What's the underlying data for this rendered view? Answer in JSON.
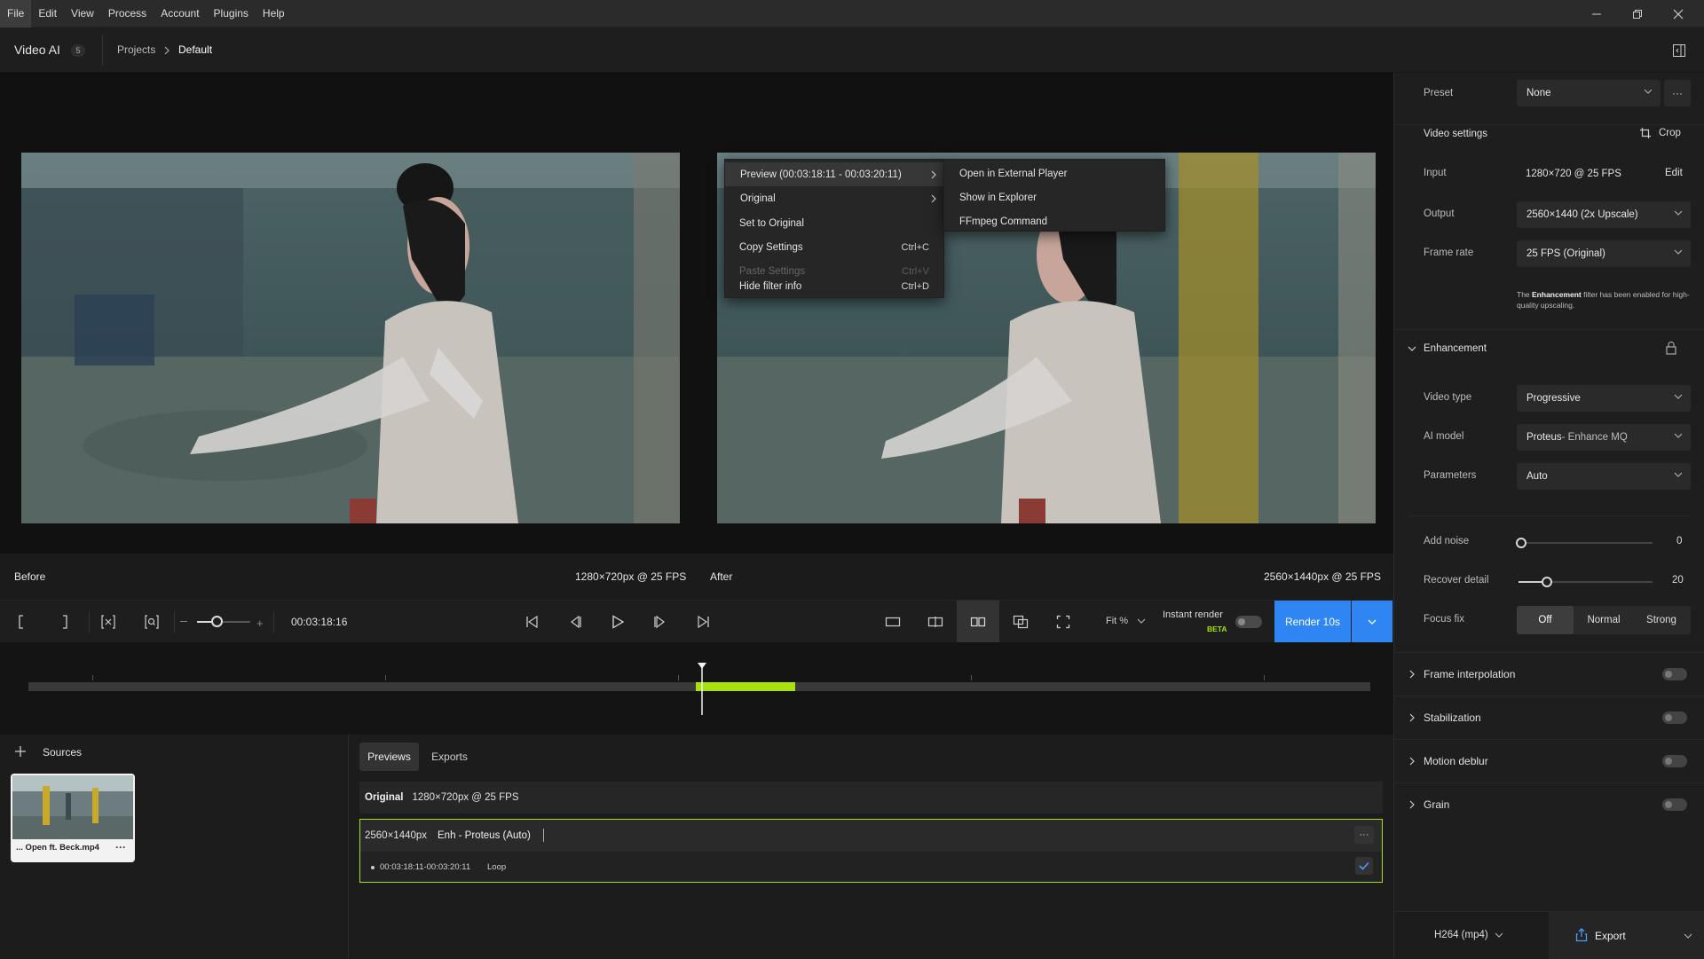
{
  "menubar": {
    "items": [
      "File",
      "Edit",
      "View",
      "Process",
      "Account",
      "Plugins",
      "Help"
    ]
  },
  "header": {
    "app_name": "Video AI",
    "app_badge": "5",
    "breadcrumb": [
      "Projects",
      "Default"
    ]
  },
  "viewer": {
    "before_label": "Before",
    "before_resolution": "1280×720px @ 25 FPS",
    "after_label": "After",
    "after_resolution": "2560×1440px @ 25 FPS"
  },
  "context_menu": {
    "items": [
      {
        "label": "Preview (00:03:18:11 - 00:03:20:11)",
        "shortcut": "",
        "submenu": true,
        "disabled": false
      },
      {
        "label": "Original",
        "shortcut": "",
        "submenu": true,
        "disabled": false
      },
      {
        "label": "Set to Original",
        "shortcut": "",
        "submenu": false,
        "disabled": false
      },
      {
        "label": "Copy Settings",
        "shortcut": "Ctrl+C",
        "submenu": false,
        "disabled": false
      },
      {
        "label": "Paste Settings",
        "shortcut": "Ctrl+V",
        "submenu": false,
        "disabled": true
      },
      {
        "label": "Hide filter info",
        "shortcut": "Ctrl+D",
        "submenu": false,
        "disabled": false
      }
    ],
    "submenu_items": [
      "Open in External Player",
      "Show in Explorer",
      "FFmpeg Command"
    ]
  },
  "transport": {
    "timecode": "00:03:18:16",
    "fit_label": "Fit %",
    "instant_render_label": "Instant render",
    "beta_label": "BETA",
    "render_label": "Render 10s"
  },
  "timeline": {
    "playhead_position": 0.5017,
    "preview_range": [
      0.4975,
      0.5712
    ]
  },
  "sources": {
    "title": "Sources",
    "items": [
      {
        "name": "... Open ft. Beck.mp4"
      }
    ]
  },
  "previews": {
    "tabs": [
      "Previews",
      "Exports"
    ],
    "active_tab": "Previews",
    "original_label": "Original",
    "original_resolution": "1280×720px @ 25 FPS",
    "items": [
      {
        "resolution": "2560×1440px",
        "model": "Enh - Proteus (Auto)",
        "range": "00:03:18:11-00:03:20:11",
        "loop_label": "Loop"
      }
    ]
  },
  "panel": {
    "preset_label": "Preset",
    "preset_value": "None",
    "video_settings_title": "Video settings",
    "crop_label": "Crop",
    "input_label": "Input",
    "input_value": "1280×720 @ 25 FPS",
    "edit_label": "Edit",
    "output_label": "Output",
    "output_value": "2560×1440 (2x Upscale)",
    "framerate_label": "Frame rate",
    "framerate_value": "25 FPS (Original)",
    "note_prefix": "The ",
    "note_bold": "Enhancement",
    "note_suffix": " filter has been enabled for high-quality upscaling.",
    "enhancement_title": "Enhancement",
    "video_type_label": "Video type",
    "video_type_value": "Progressive",
    "ai_model_label": "AI model",
    "ai_model_value": "Proteus",
    "ai_model_sub": " - Enhance MQ",
    "parameters_label": "Parameters",
    "parameters_value": "Auto",
    "add_noise_label": "Add noise",
    "add_noise_value": "0",
    "recover_detail_label": "Recover detail",
    "recover_detail_value": "20",
    "focus_fix_label": "Focus fix",
    "focus_fix_options": [
      "Off",
      "Normal",
      "Strong"
    ],
    "focus_fix_selected": "Off",
    "sections": [
      "Frame interpolation",
      "Stabilization",
      "Motion deblur",
      "Grain"
    ],
    "codec_label": "H264 (mp4)",
    "export_label": "Export"
  },
  "colors": {
    "accent_blue": "#2f86f2",
    "accent_green": "#a9e10d"
  }
}
